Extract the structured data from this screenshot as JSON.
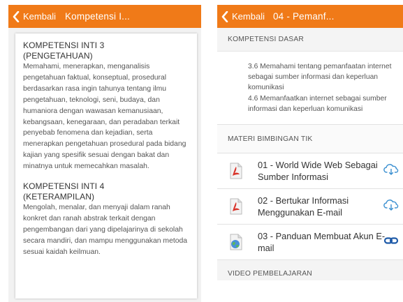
{
  "left_screen": {
    "header": {
      "back_label": "Kembali",
      "title": "Kompetensi I..."
    },
    "sections": [
      {
        "heading_line1": "KOMPETENSI INTI 3",
        "heading_line2": "(PENGETAHUAN)",
        "body": "Memahami, menerapkan, menganalisis pengetahuan faktual, konseptual, prosedural berdasarkan rasa ingin tahunya tentang ilmu pengetahuan, teknologi, seni, budaya, dan humaniora dengan wawasan kemanusiaan, kebangsaan, kenegaraan, dan peradaban terkait penyebab fenomena dan kejadian, serta menerapkan pengetahuan prosedural pada bidang kajian yang spesifik sesuai dengan bakat dan minatnya untuk memecahkan masalah."
      },
      {
        "heading_line1": "KOMPETENSI INTI 4",
        "heading_line2": "(KETERAMPILAN)",
        "body": "Mengolah, menalar, dan menyaji dalam ranah konkret dan ranah abstrak terkait dengan pengembangan dari yang dipelajarinya di sekolah secara mandiri, dan mampu menggunakan metoda sesuai kaidah keilmuan."
      }
    ]
  },
  "right_screen": {
    "header": {
      "back_label": "Kembali",
      "title": "04 - Pemanf..."
    },
    "kompetensi_dasar": {
      "heading": "KOMPETENSI DASAR",
      "items": [
        "3.6  Memahami tentang pemanfaatan internet sebagai sumber informasi dan keperluan komunikasi",
        "4.6  Memanfaatkan internet sebagai sumber informasi dan keperluan komunikasi"
      ]
    },
    "materi": {
      "heading": "MATERI BIMBINGAN TIK",
      "items": [
        {
          "title": "01 - World Wide Web Sebagai Sumber Informasi",
          "file_icon": "pdf-file-icon",
          "action_icon": "cloud-download-icon"
        },
        {
          "title": "02 - Bertukar Informasi Menggunakan E-mail",
          "file_icon": "pdf-file-icon",
          "action_icon": "cloud-download-icon"
        },
        {
          "title": "03 - Panduan Membuat Akun E-mail",
          "file_icon": "web-file-icon",
          "action_icon": "link-icon"
        }
      ]
    },
    "video_heading": "VIDEO PEMBELAJARAN"
  },
  "colors": {
    "header_orange": "#f07a18",
    "pdf_red": "#d9342b",
    "link_blue": "#1e5aa8",
    "cloud_blue": "#3a8fd0"
  }
}
